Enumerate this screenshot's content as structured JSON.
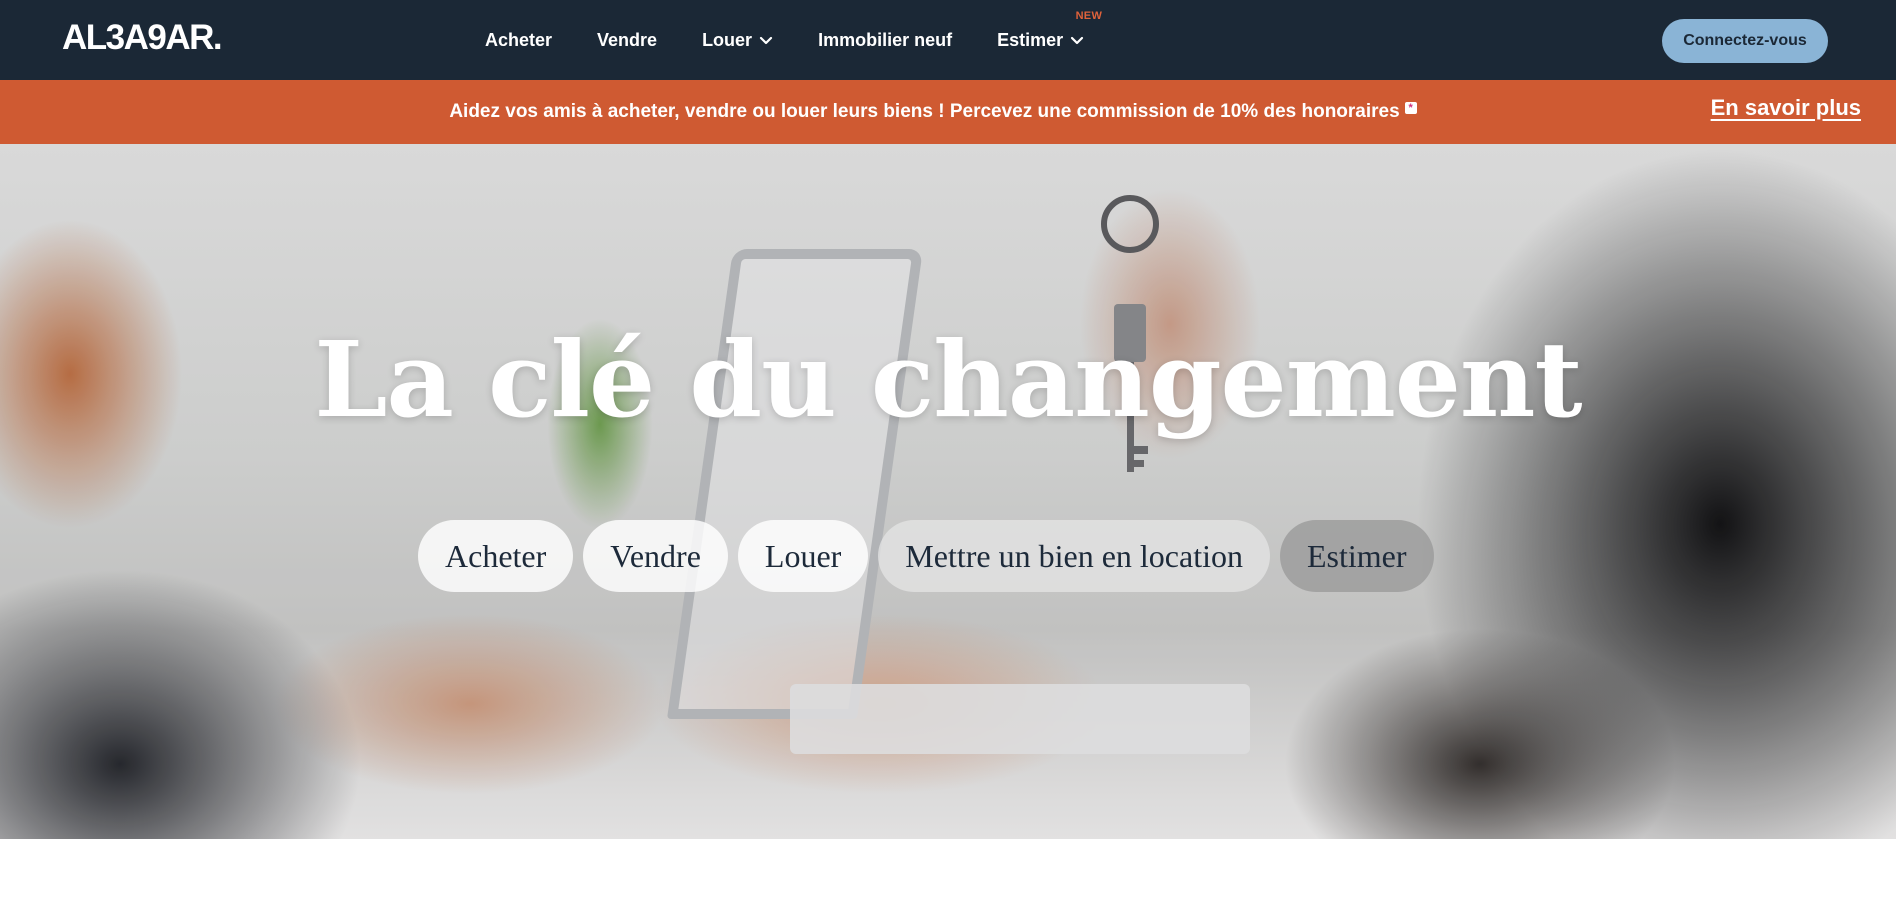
{
  "header": {
    "logo": "AL3A9AR.",
    "nav": [
      {
        "label": "Acheter",
        "has_dropdown": false
      },
      {
        "label": "Vendre",
        "has_dropdown": false
      },
      {
        "label": "Louer",
        "has_dropdown": true
      },
      {
        "label": "Immobilier neuf",
        "has_dropdown": false
      },
      {
        "label": "Estimer",
        "has_dropdown": true,
        "badge": "NEW"
      }
    ],
    "login_button": "Connectez-vous"
  },
  "promo": {
    "text": "Aidez vos amis à acheter, vendre ou louer leurs biens ! Percevez une commission de 10% des honoraires",
    "star": "*",
    "link": "En savoir plus"
  },
  "hero": {
    "title": "La clé du changement",
    "chips": [
      "Acheter",
      "Vendre",
      "Louer",
      "Mettre un bien en location",
      "Estimer"
    ]
  },
  "colors": {
    "navbar": "#1b2836",
    "promo": "#cf5a32",
    "login_button": "#8ab4d6",
    "new_badge": "#e0623b"
  },
  "icons": [
    "chevron-down-icon",
    "star-icon"
  ]
}
